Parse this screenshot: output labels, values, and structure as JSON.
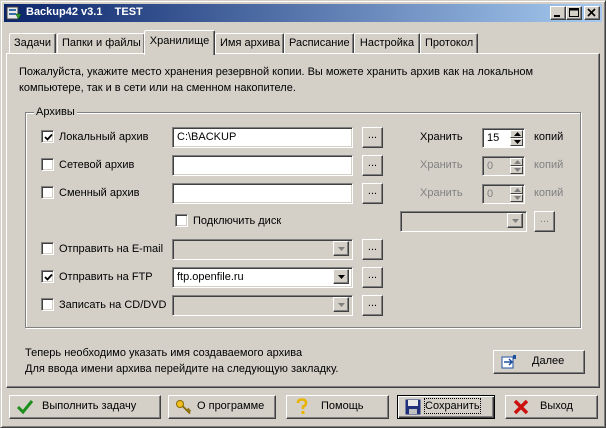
{
  "window": {
    "title": "Backup42 v3.1    TEST",
    "minimize_glyph": "_",
    "maximize_glyph": "□",
    "close_glyph": "×"
  },
  "tabs": [
    {
      "label": "Задачи",
      "active": false
    },
    {
      "label": "Папки и файлы",
      "active": false
    },
    {
      "label": "Хранилище",
      "active": true
    },
    {
      "label": "Имя архива",
      "active": false
    },
    {
      "label": "Расписание",
      "active": false
    },
    {
      "label": "Настройка",
      "active": false
    },
    {
      "label": "Протокол",
      "active": false
    }
  ],
  "storage": {
    "description": "Пожалуйста, укажите место хранения резервной копии. Вы можете хранить архив как на локальном компьютере, так и в сети или на сменном накопителе.",
    "group_title": "Архивы",
    "local": {
      "label": "Локальный архив",
      "checked": true,
      "path": "C:\\BACKUP",
      "keep_label": "Хранить",
      "keep_value": "15",
      "copies_label": "копий"
    },
    "network": {
      "label": "Сетевой архив",
      "checked": false,
      "path": "",
      "keep_label": "Хранить",
      "keep_value": "0",
      "copies_label": "копий"
    },
    "removable": {
      "label": "Сменный архив",
      "checked": false,
      "path": "",
      "keep_label": "Хранить",
      "keep_value": "0",
      "copies_label": "копий"
    },
    "connect_disk": {
      "label": "Подключить диск",
      "checked": false
    },
    "email": {
      "label": "Отправить на E-mail",
      "checked": false,
      "value": ""
    },
    "ftp": {
      "label": "Отправить на FTP",
      "checked": true,
      "value": "ftp.openfile.ru"
    },
    "cd": {
      "label": "Записать на CD/DVD",
      "checked": false,
      "value": ""
    },
    "browse_label": "...",
    "drive_select_value": "",
    "hint_line1": "Теперь необходимо указать имя создаваемого архива",
    "hint_line2": "Для ввода имени архива перейдите на следующую закладку.",
    "next_label": "Далее"
  },
  "footer": {
    "run_label": "Выполнить задачу",
    "about_label": "О программе",
    "help_label": "Помощь",
    "save_label": "Сохранить",
    "exit_label": "Выход"
  },
  "colors": {
    "titlebar_start": "#0a246a",
    "titlebar_end": "#a6caf0",
    "face": "#d4d0c8"
  }
}
